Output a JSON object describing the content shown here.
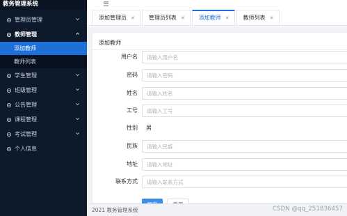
{
  "app": {
    "title": "教务管理系统"
  },
  "sidebar": {
    "items": [
      {
        "label": "管理员管理",
        "icon": "settings-gear-icon",
        "expanded": false
      },
      {
        "label": "教师管理",
        "icon": "settings-gear-icon",
        "expanded": true,
        "children": [
          {
            "label": "添加教师",
            "active": true
          },
          {
            "label": "教师列表",
            "active": false
          }
        ]
      },
      {
        "label": "学生管理",
        "icon": "settings-gear-icon",
        "expanded": false
      },
      {
        "label": "班级管理",
        "icon": "settings-gear-icon",
        "expanded": false
      },
      {
        "label": "公告管理",
        "icon": "settings-gear-icon",
        "expanded": false
      },
      {
        "label": "课程管理",
        "icon": "settings-gear-icon",
        "expanded": false
      },
      {
        "label": "考试管理",
        "icon": "settings-gear-icon",
        "expanded": false
      },
      {
        "label": "个人信息",
        "icon": "settings-gear-icon",
        "expanded": false
      }
    ]
  },
  "tabs": [
    {
      "label": "添加管理员",
      "closable": true,
      "active": false
    },
    {
      "label": "管理员列表",
      "closable": true,
      "active": false
    },
    {
      "label": "添加教师",
      "closable": true,
      "active": true
    },
    {
      "label": "教师列表",
      "closable": true,
      "active": false
    }
  ],
  "card": {
    "title": "添加教师"
  },
  "form": {
    "username": {
      "label": "用户名",
      "placeholder": "请输入用户名",
      "value": ""
    },
    "password": {
      "label": "密码",
      "placeholder": "请输入密码",
      "value": ""
    },
    "name": {
      "label": "姓名",
      "placeholder": "请输入姓名",
      "value": ""
    },
    "employee_no": {
      "label": "工号",
      "placeholder": "请输入工号",
      "value": ""
    },
    "gender": {
      "label": "性别",
      "value": "男"
    },
    "ethnicity": {
      "label": "民族",
      "placeholder": "请输入民族",
      "value": ""
    },
    "address": {
      "label": "地址",
      "placeholder": "请输入地址",
      "value": ""
    },
    "contact": {
      "label": "联系方式",
      "placeholder": "请输入联系方式",
      "value": ""
    },
    "submit_label": "提交",
    "reset_label": "重置"
  },
  "footer": {
    "text": "2021 教务管理系统"
  },
  "watermark": {
    "text": "CSDN @qq_251836457"
  },
  "colors": {
    "sidebar_bg": "#0d1a2b",
    "active_menu": "#1f6fd8",
    "primary": "#3a8ee6",
    "content_bg": "#f0f2f5"
  }
}
